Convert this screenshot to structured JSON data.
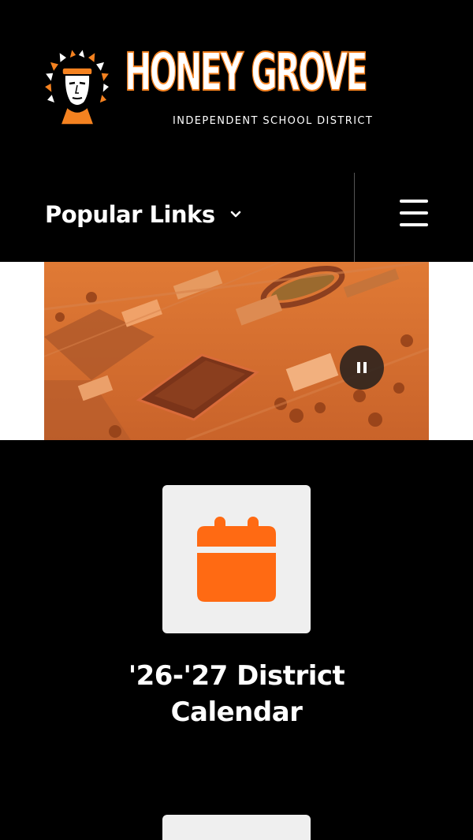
{
  "brand": {
    "name": "HONEY GROVE",
    "subtitle": "INDEPENDENT SCHOOL DISTRICT",
    "accent_color": "#f58220",
    "mascot_icon": "indian-chief-mascot-icon"
  },
  "nav": {
    "popular_links_label": "Popular Links",
    "dropdown_icon": "chevron-down-icon",
    "menu_icon": "hamburger-menu-icon"
  },
  "hero": {
    "media": "aerial-campus-photo",
    "pause_icon": "pause-icon"
  },
  "quick_links": [
    {
      "icon": "calendar-icon",
      "label_line1": "'26-'27 District",
      "label_line2": "Calendar",
      "icon_color": "#ff6a13"
    }
  ]
}
